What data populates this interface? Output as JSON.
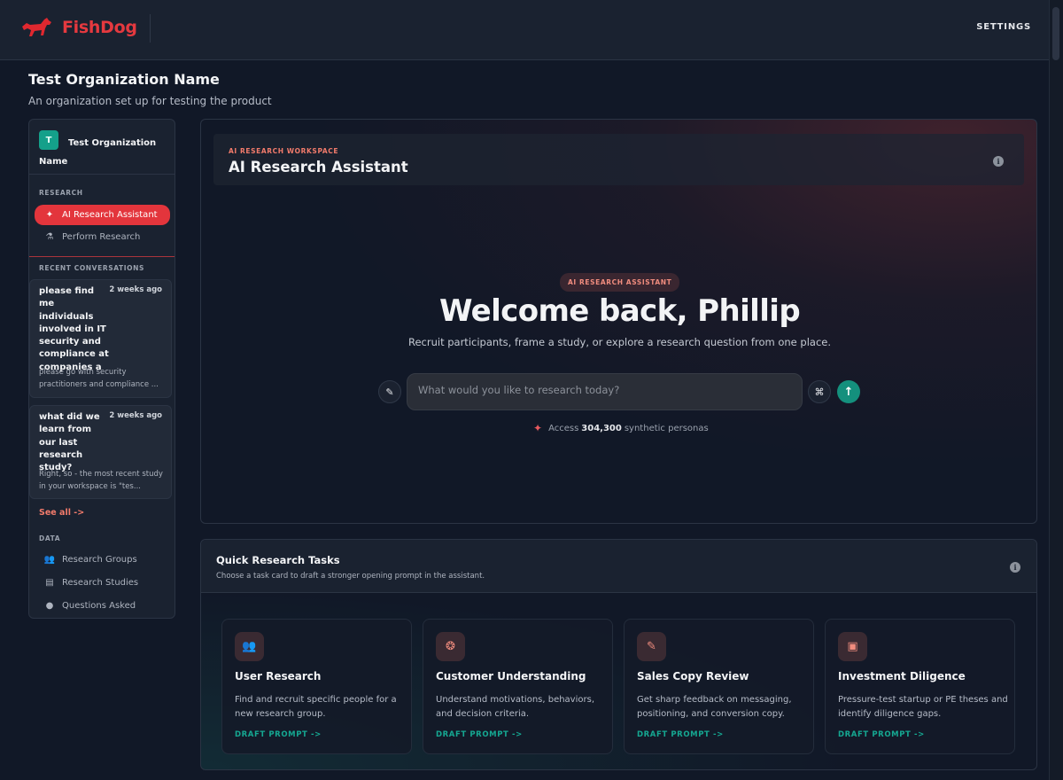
{
  "brand": {
    "name": "FishDog",
    "logo_icon": "red-dog-logo"
  },
  "topbar": {
    "settings_label": "SETTINGS"
  },
  "org": {
    "title": "Test Organization Name",
    "subtitle": "An organization set up for testing the product"
  },
  "sidebar": {
    "org_card": {
      "avatar_letter": "T",
      "name": "Test Organization Name"
    },
    "research_label": "RESEARCH",
    "research_items": [
      {
        "label": "AI Research Assistant",
        "icon": "sparkle-icon",
        "active": true
      },
      {
        "label": "Perform Research",
        "icon": "flask-icon",
        "active": false
      }
    ],
    "recent_label": "RECENT CONVERSATIONS",
    "conversations": [
      {
        "title": "please find me individuals involved in IT security and compliance at companies a",
        "date": "2 weeks ago",
        "snippet": "please go with security practitioners and compliance ..."
      },
      {
        "title": "what did we learn from our last research study?",
        "date": "2 weeks ago",
        "snippet": "Right, so - the most recent study in your workspace is \"tes..."
      }
    ],
    "see_all": "See all  ->",
    "data_label": "DATA",
    "data_items": [
      {
        "label": "Research Groups",
        "icon": "people-icon"
      },
      {
        "label": "Research Studies",
        "icon": "document-icon"
      },
      {
        "label": "Questions Asked",
        "icon": "chat-bubble-icon"
      }
    ]
  },
  "assistant": {
    "kicker": "AI RESEARCH WORKSPACE",
    "title": "AI Research Assistant",
    "pill": "AI RESEARCH ASSISTANT",
    "welcome": "Welcome back, Phillip",
    "subtitle": "Recruit participants, frame a study, or explore a research question from one place.",
    "input_placeholder": "What would you like to research today?",
    "input_value": "",
    "personas_prefix": "Access",
    "personas_count": "304,300",
    "personas_suffix": "synthetic personas"
  },
  "tasks": {
    "title": "Quick Research Tasks",
    "subtitle": "Choose a task card to draft a stronger opening prompt in the assistant.",
    "cards": [
      {
        "title": "User Research",
        "desc": "Find and recruit specific people for a new research group.",
        "cta": "DRAFT PROMPT  ->",
        "icon": "people-icon"
      },
      {
        "title": "Customer Understanding",
        "desc": "Understand motivations, behaviors, and decision criteria.",
        "cta": "DRAFT PROMPT  ->",
        "icon": "brain-icon"
      },
      {
        "title": "Sales Copy Review",
        "desc": "Get sharp feedback on messaging, positioning, and conversion copy.",
        "cta": "DRAFT PROMPT  ->",
        "icon": "pencil-ruler-icon"
      },
      {
        "title": "Investment Diligence",
        "desc": "Pressure-test startup or PE theses and identify diligence gaps.",
        "cta": "DRAFT PROMPT  ->",
        "icon": "briefcase-icon"
      }
    ]
  },
  "colors": {
    "accent_red": "#e3353c",
    "accent_teal": "#14907d",
    "background": "#111827"
  }
}
